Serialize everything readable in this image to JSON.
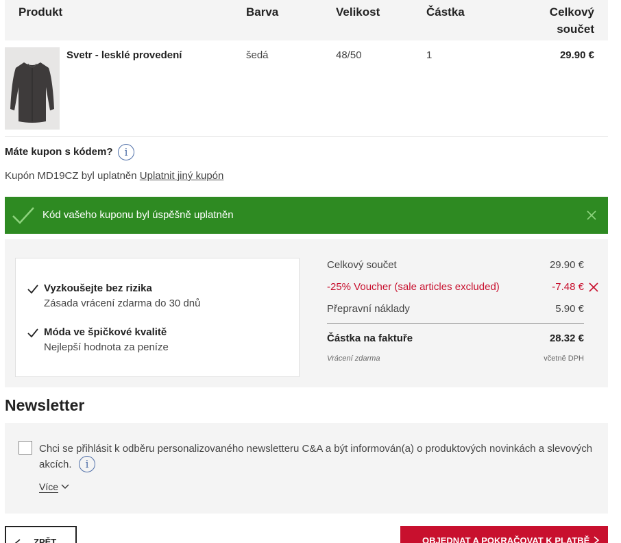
{
  "table": {
    "headers": {
      "product": "Produkt",
      "color": "Barva",
      "size": "Velikost",
      "quantity": "Částka",
      "total": "Celkový součet"
    },
    "items": [
      {
        "name": "Svetr - lesklé provedení",
        "color": "šedá",
        "size": "48/50",
        "quantity": "1",
        "total": "29.90 €"
      }
    ]
  },
  "coupon": {
    "question": "Máte kupon s kódem?",
    "applied_text": "Kupón MD19CZ byl uplatněn",
    "other_link": "Uplatnit jiný kupón",
    "success_message": "Kód vašeho kuponu byl úspěšně uplatněn"
  },
  "benefits": [
    {
      "title": "Vyzkoušejte bez rizika",
      "subtitle": "Zásada vrácení zdarma do 30 dnů"
    },
    {
      "title": "Móda ve špičkové kvalitě",
      "subtitle": "Nejlepší hodnota za peníze"
    }
  ],
  "totals": {
    "subtotal_label": "Celkový součet",
    "subtotal_value": "29.90 €",
    "voucher_label": "-25% Voucher (sale articles excluded)",
    "voucher_value": "-7.48 €",
    "shipping_label": "Přepravní náklady",
    "shipping_value": "5.90 €",
    "invoice_label": "Částka na faktuře",
    "invoice_value": "28.32 €",
    "returns_note": "Vrácení zdarma",
    "vat_note": "včetně DPH"
  },
  "newsletter": {
    "title": "Newsletter",
    "consent_text": "Chci se přihlásit k odběru personalizovaného newsletteru C&A a být informován(a) o produktových novinkách a slevových akcích.",
    "more_label": "Více"
  },
  "buttons": {
    "back": "ZPĚT",
    "order": "OBJEDNAT A POKRAČOVAT K PLATBĚ"
  },
  "colors": {
    "success_green": "#2e8a22",
    "accent_red": "#c8102e",
    "info_blue": "#4f6fa8"
  }
}
